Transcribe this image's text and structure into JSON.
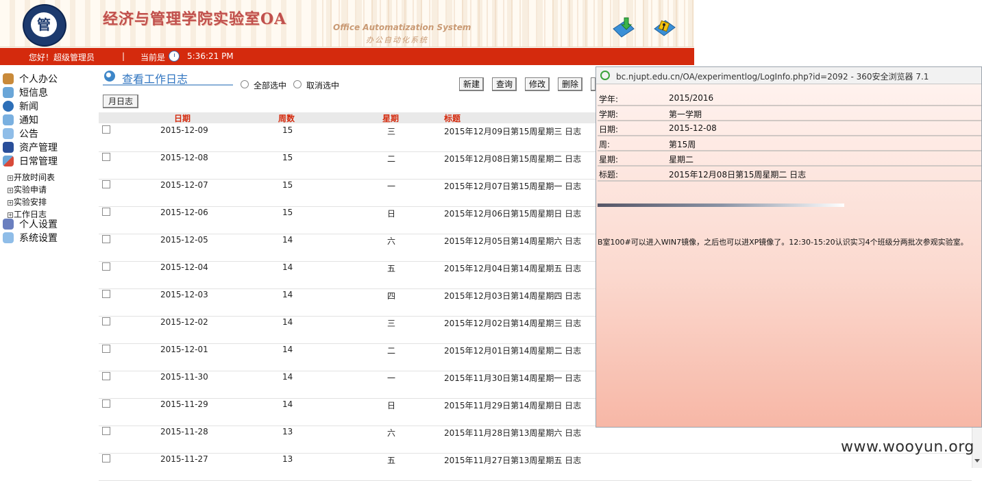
{
  "header": {
    "logo_text": "管",
    "title": "经济与管理学院实验室OA",
    "subtitle_en": "Office Automatization System",
    "subtitle_cn": "办公自动化系统",
    "icons": [
      "download-icon",
      "exit-icon"
    ]
  },
  "status": {
    "greeting": "您好！超级管理员",
    "separator": "|",
    "time_label": "当前是",
    "time": "5:36:21 PM"
  },
  "sidebar": {
    "items": [
      {
        "label": "个人办公",
        "icon": "person-icon"
      },
      {
        "label": "短信息",
        "icon": "message-icon"
      },
      {
        "label": "新闻",
        "icon": "globe-icon"
      },
      {
        "label": "通知",
        "icon": "notice-icon"
      },
      {
        "label": "公告",
        "icon": "announcement-icon"
      },
      {
        "label": "资产管理",
        "icon": "asset-icon"
      },
      {
        "label": "日常管理",
        "icon": "daily-icon"
      }
    ],
    "sub_items": [
      "开放时间表",
      "实验申请",
      "实验安排",
      "工作日志"
    ],
    "items_after": [
      {
        "label": "个人设置",
        "icon": "tools-icon"
      },
      {
        "label": "系统设置",
        "icon": "settings-icon"
      }
    ]
  },
  "main": {
    "title": "查看工作日志",
    "select_all": "全部选中",
    "deselect_all": "取消选中",
    "buttons": [
      "新建",
      "查询",
      "修改",
      "删除"
    ],
    "month_button": "月日志",
    "columns": [
      "日期",
      "周数",
      "星期",
      "标题"
    ],
    "rows": [
      {
        "date": "2015-12-09",
        "week": "15",
        "day": "三",
        "title": "2015年12月09日第15周星期三 日志"
      },
      {
        "date": "2015-12-08",
        "week": "15",
        "day": "二",
        "title": "2015年12月08日第15周星期二 日志"
      },
      {
        "date": "2015-12-07",
        "week": "15",
        "day": "一",
        "title": "2015年12月07日第15周星期一 日志"
      },
      {
        "date": "2015-12-06",
        "week": "15",
        "day": "日",
        "title": "2015年12月06日第15周星期日 日志"
      },
      {
        "date": "2015-12-05",
        "week": "14",
        "day": "六",
        "title": "2015年12月05日第14周星期六 日志"
      },
      {
        "date": "2015-12-04",
        "week": "14",
        "day": "五",
        "title": "2015年12月04日第14周星期五 日志"
      },
      {
        "date": "2015-12-03",
        "week": "14",
        "day": "四",
        "title": "2015年12月03日第14周星期四 日志"
      },
      {
        "date": "2015-12-02",
        "week": "14",
        "day": "三",
        "title": "2015年12月02日第14周星期三 日志"
      },
      {
        "date": "2015-12-01",
        "week": "14",
        "day": "二",
        "title": "2015年12月01日第14周星期二 日志"
      },
      {
        "date": "2015-11-30",
        "week": "14",
        "day": "一",
        "title": "2015年11月30日第14周星期一 日志"
      },
      {
        "date": "2015-11-29",
        "week": "14",
        "day": "日",
        "title": "2015年11月29日第14周星期日 日志"
      },
      {
        "date": "2015-11-28",
        "week": "13",
        "day": "六",
        "title": "2015年11月28日第13周星期六 日志"
      },
      {
        "date": "2015-11-27",
        "week": "13",
        "day": "五",
        "title": "2015年11月27日第13周星期五 日志"
      }
    ]
  },
  "popup": {
    "window_title": "bc.njupt.edu.cn/OA/experimentlog/LogInfo.php?id=2092 - 360安全浏览器 7.1",
    "fields": [
      {
        "key": "学年:",
        "value": "2015/2016"
      },
      {
        "key": "学期:",
        "value": "第一学期"
      },
      {
        "key": "日期:",
        "value": "2015-12-08"
      },
      {
        "key": "周:",
        "value": "第15周"
      },
      {
        "key": "星期:",
        "value": "星期二"
      },
      {
        "key": "标题:",
        "value": "2015年12月08日第15周星期二 日志"
      }
    ],
    "content": "B室100#可以进入WIN7镜像，之后也可以进XP镜像了。12:30-15:20认识实习4个班级分两批次参观实验室。"
  },
  "watermark": "www.wooyun.org",
  "colors": {
    "status_bar": "#d42a0d",
    "header_text": "#d42a0d",
    "title_blue": "#2f74c0"
  }
}
